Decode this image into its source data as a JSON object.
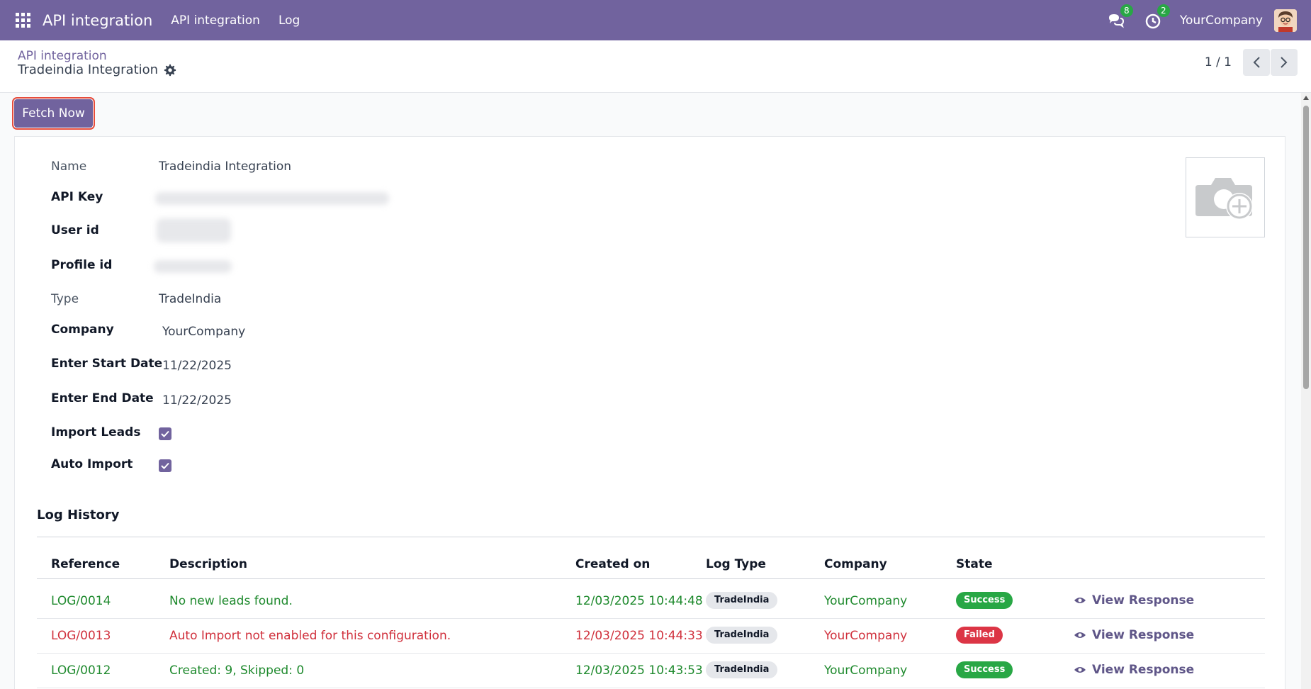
{
  "navbar": {
    "app_title": "API integration",
    "menu": [
      "API integration",
      "Log"
    ],
    "messages_count": "8",
    "activities_count": "2",
    "company": "YourCompany"
  },
  "control_panel": {
    "breadcrumb": "API integration",
    "record_title": "Tradeindia Integration",
    "pager": "1 / 1"
  },
  "actions": {
    "fetch_now": "Fetch Now"
  },
  "form": {
    "name_label": "Name",
    "name_value": "Tradeindia Integration",
    "api_key_label": "API Key",
    "user_id_label": "User id",
    "profile_id_label": "Profile id",
    "type_label": "Type",
    "type_value": "TradeIndia",
    "company_label": "Company",
    "company_value": "YourCompany",
    "start_date_label": "Enter Start Date",
    "start_date_value": "11/22/2025",
    "end_date_label": "Enter End Date",
    "end_date_value": "11/22/2025",
    "import_leads_label": "Import Leads",
    "import_leads_checked": true,
    "auto_import_label": "Auto Import",
    "auto_import_checked": true
  },
  "log_history": {
    "title": "Log History",
    "columns": [
      "Reference",
      "Description",
      "Created on",
      "Log Type",
      "Company",
      "State"
    ],
    "view_label": "View Response",
    "rows": [
      {
        "reference": "LOG/0014",
        "description": "No new leads found.",
        "created_on": "12/03/2025 10:44:48",
        "log_type": "TradeIndia",
        "company": "YourCompany",
        "state": "Success"
      },
      {
        "reference": "LOG/0013",
        "description": "Auto Import not enabled for this configuration.",
        "created_on": "12/03/2025 10:44:33",
        "log_type": "TradeIndia",
        "company": "YourCompany",
        "state": "Failed"
      },
      {
        "reference": "LOG/0012",
        "description": "Created: 9, Skipped: 0",
        "created_on": "12/03/2025 10:43:53",
        "log_type": "TradeIndia",
        "company": "YourCompany",
        "state": "Success"
      }
    ]
  },
  "colors": {
    "brand": "#71639e",
    "success": "#28a745",
    "failed": "#dc3545"
  }
}
